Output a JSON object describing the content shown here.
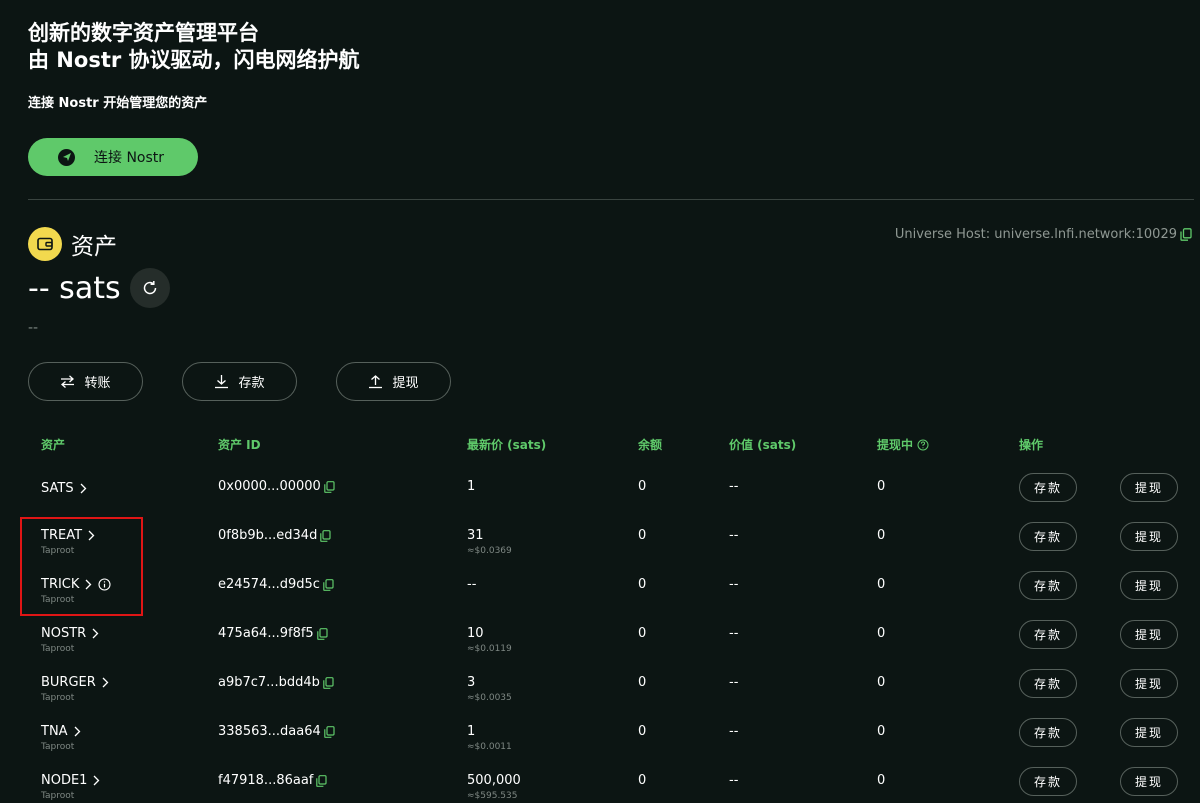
{
  "hero": {
    "line1": "创新的数字资产管理平台",
    "line2": "由 Nostr 协议驱动，闪电网络护航",
    "subtitle": "连接 Nostr 开始管理您的资产",
    "connect_label": "连接 Nostr"
  },
  "assets": {
    "title": "资产",
    "universe_host": "Universe Host: universe.lnfi.network:10029",
    "balance": "-- sats",
    "fiat": "--"
  },
  "actions": {
    "transfer": "转账",
    "deposit": "存款",
    "withdraw": "提现"
  },
  "table": {
    "headers": {
      "asset": "资产",
      "asset_id": "资产 ID",
      "price": "最新价 (sats)",
      "balance": "余额",
      "value": "价值 (sats)",
      "withdrawing": "提现中",
      "ops": "操作"
    },
    "deposit_label": "存款",
    "withdraw_label": "提现",
    "rows": [
      {
        "name": "SATS",
        "type": "",
        "id": "0x0000...00000",
        "price": "1",
        "usd": "",
        "balance": "0",
        "value": "--",
        "withdrawing": "0"
      },
      {
        "name": "TREAT",
        "type": "Taproot",
        "id": "0f8b9b...ed34d",
        "price": "31",
        "usd": "≈$0.0369",
        "balance": "0",
        "value": "--",
        "withdrawing": "0"
      },
      {
        "name": "TRICK",
        "type": "Taproot",
        "id": "e24574...d9d5c",
        "price": "--",
        "usd": "",
        "balance": "0",
        "value": "--",
        "withdrawing": "0"
      },
      {
        "name": "NOSTR",
        "type": "Taproot",
        "id": "475a64...9f8f5",
        "price": "10",
        "usd": "≈$0.0119",
        "balance": "0",
        "value": "--",
        "withdrawing": "0"
      },
      {
        "name": "BURGER",
        "type": "Taproot",
        "id": "a9b7c7...bdd4b",
        "price": "3",
        "usd": "≈$0.0035",
        "balance": "0",
        "value": "--",
        "withdrawing": "0"
      },
      {
        "name": "TNA",
        "type": "Taproot",
        "id": "338563...daa64",
        "price": "1",
        "usd": "≈$0.0011",
        "balance": "0",
        "value": "--",
        "withdrawing": "0"
      },
      {
        "name": "NODE1",
        "type": "Taproot",
        "id": "f47918...86aaf",
        "price": "500,000",
        "usd": "≈$595.535",
        "balance": "0",
        "value": "--",
        "withdrawing": "0"
      }
    ]
  },
  "colors": {
    "background": "#0c1513",
    "accent_green": "#5fc96a",
    "wallet_yellow": "#f2d94e",
    "highlight_red": "#e01515"
  },
  "icons": {
    "connect": "paper-plane-icon",
    "wallet": "wallet-icon",
    "refresh": "refresh-icon",
    "copy": "copy-icon",
    "transfer": "swap-arrows-icon",
    "deposit": "download-icon",
    "withdraw": "upload-icon",
    "chevron": "chevron-right-icon",
    "info": "info-icon",
    "help": "help-circle-icon"
  }
}
